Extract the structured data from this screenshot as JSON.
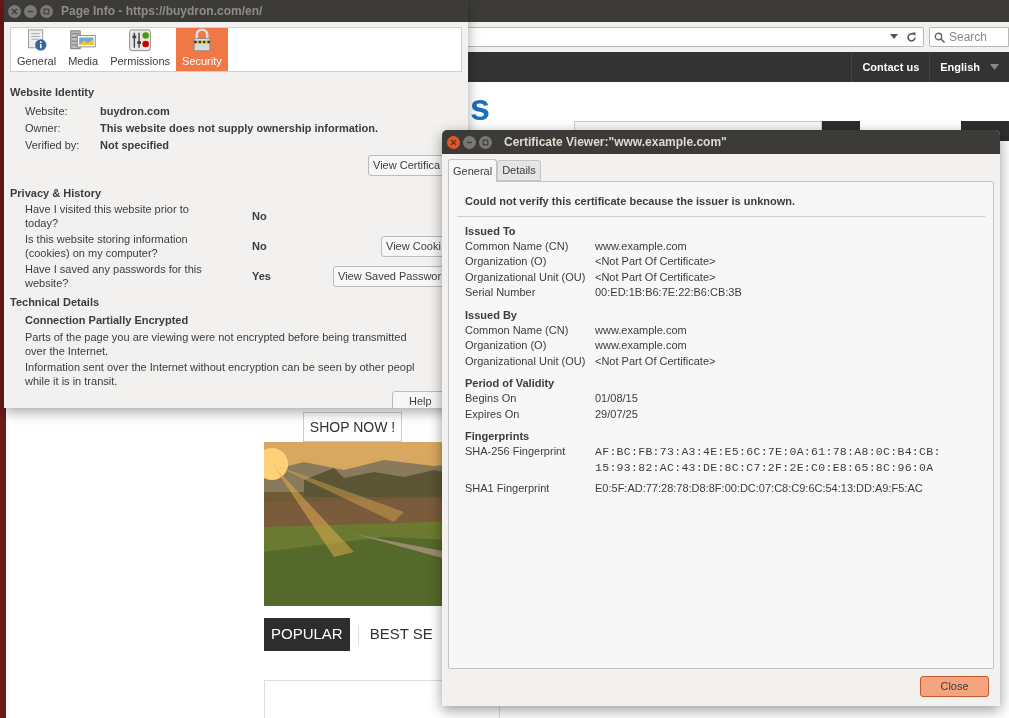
{
  "browser": {
    "search_placeholder": "Search",
    "nav": [
      {
        "label": "Contact us"
      },
      {
        "label": "English"
      }
    ],
    "logo_fragment": "s",
    "hero_button": "SHOP NOW !",
    "product_tabs": [
      {
        "label": "POPULAR",
        "selected": true
      },
      {
        "label": "BEST SE",
        "selected": false
      }
    ]
  },
  "page_info": {
    "title": "Page Info - https://buydron.com/en/",
    "tabs": [
      {
        "label": "General",
        "selected": false
      },
      {
        "label": "Media",
        "selected": false
      },
      {
        "label": "Permissions",
        "selected": false
      },
      {
        "label": "Security",
        "selected": true
      }
    ],
    "identity": {
      "heading": "Website Identity",
      "rows": [
        {
          "label": "Website:",
          "value": "buydron.com"
        },
        {
          "label": "Owner:",
          "value": "This website does not supply ownership information."
        },
        {
          "label": "Verified by:",
          "value": "Not specified"
        }
      ],
      "button": "View Certifica"
    },
    "privacy": {
      "heading": "Privacy & History",
      "rows": [
        {
          "question": "Have I visited this website prior to\ntoday?",
          "answer": "No"
        },
        {
          "question": "Is this website storing information\n(cookies) on my computer?",
          "answer": "No",
          "button": "View Cooki"
        },
        {
          "question": "Have I saved any passwords for this\nwebsite?",
          "answer": "Yes",
          "button": "View Saved Passwor"
        }
      ]
    },
    "technical": {
      "heading": "Technical Details",
      "subheading": "Connection Partially Encrypted",
      "paragraphs": [
        "Parts of the page you are viewing were not encrypted before being transmitted\nover the Internet.",
        "Information sent over the Internet without encryption can be seen by other peopl\nwhile it is in transit."
      ]
    },
    "help_button": "Help"
  },
  "certificate_viewer": {
    "title": "Certificate Viewer:\"www.example.com\"",
    "tabs": [
      {
        "label": "General",
        "selected": true
      },
      {
        "label": "Details",
        "selected": false
      }
    ],
    "message": "Could not verify this certificate because the issuer is unknown.",
    "sections": [
      {
        "heading": "Issued To",
        "rows": [
          {
            "label": "Common Name (CN)",
            "value": "www.example.com"
          },
          {
            "label": "Organization (O)",
            "value": "<Not Part Of Certificate>"
          },
          {
            "label": "Organizational Unit (OU)",
            "value": "<Not Part Of Certificate>"
          },
          {
            "label": "Serial Number",
            "value": "00:ED:1B:B6:7E:22:B6:CB:3B"
          }
        ]
      },
      {
        "heading": "Issued By",
        "rows": [
          {
            "label": "Common Name (CN)",
            "value": "www.example.com"
          },
          {
            "label": "Organization (O)",
            "value": "www.example.com"
          },
          {
            "label": "Organizational Unit (OU)",
            "value": "<Not Part Of Certificate>"
          }
        ]
      },
      {
        "heading": "Period of Validity",
        "rows": [
          {
            "label": "Begins On",
            "value": "01/08/15"
          },
          {
            "label": "Expires On",
            "value": "29/07/25"
          }
        ]
      },
      {
        "heading": "Fingerprints",
        "rows": [
          {
            "label": "SHA-256 Fingerprint",
            "value": "AF:BC:FB:73:A3:4E:E5:6C:7E:0A:61:78:A8:0C:B4:CB:\n15:93:82:AC:43:DE:8C:C7:2F:2E:C0:E8:65:8C:96:0A",
            "kind": "mono"
          },
          {
            "label": "SHA1 Fingerprint",
            "value": "E0:5F:AD:77:28:78:D8:8F:00:DC:07:C8:C9:6C:54:13:DD:A9:F5:AC",
            "kind": "plain"
          }
        ]
      }
    ],
    "close_button": "Close"
  }
}
